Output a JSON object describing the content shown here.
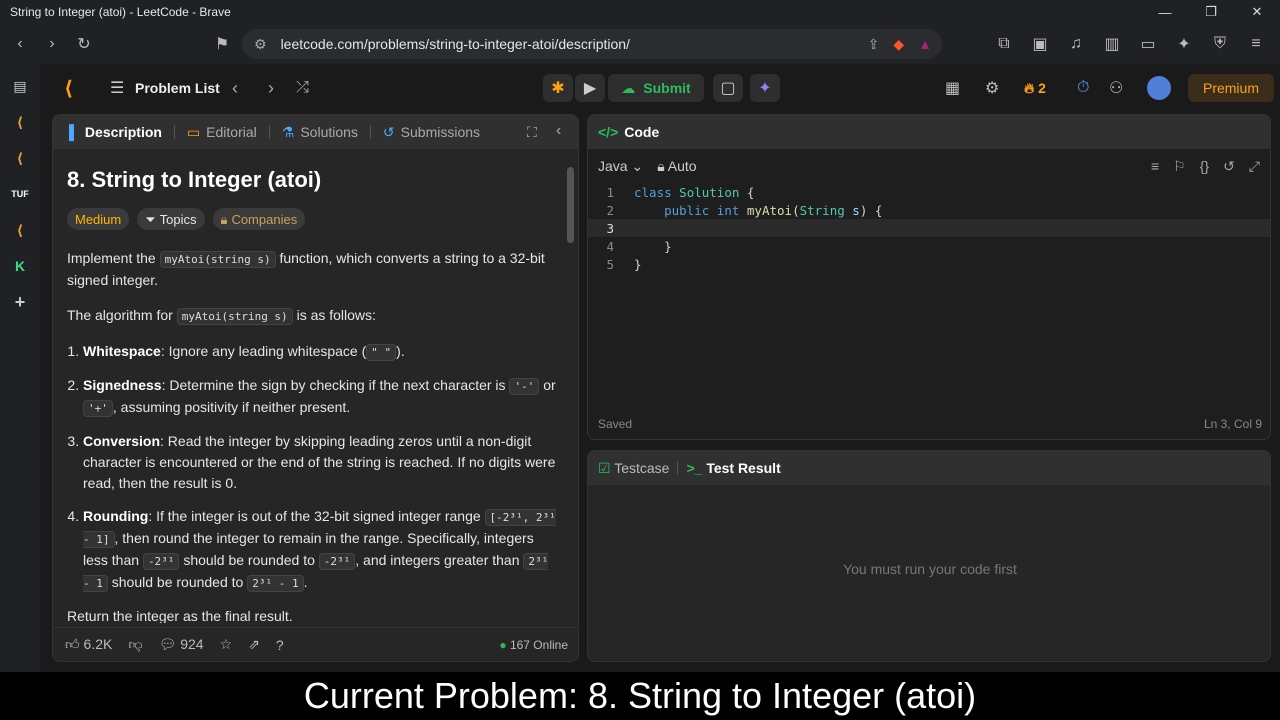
{
  "window": {
    "title": "String to Integer (atoi) - LeetCode - Brave",
    "minimize": "—",
    "restore": "❐",
    "close": "✕"
  },
  "browser": {
    "url": "leetcode.com/problems/string-to-integer-atoi/description/"
  },
  "lcnav": {
    "problem_list": "Problem List",
    "submit": "Submit",
    "streak": "2",
    "premium": "Premium"
  },
  "left_tabs": {
    "description": "Description",
    "editorial": "Editorial",
    "solutions": "Solutions",
    "submissions": "Submissions"
  },
  "problem": {
    "title": "8. String to Integer (atoi)",
    "difficulty": "Medium",
    "topics": "Topics",
    "companies": "Companies",
    "p1_a": "Implement the ",
    "p1_code": "myAtoi(string s)",
    "p1_b": " function, which converts a string to a 32-bit signed integer.",
    "p2_a": "The algorithm for ",
    "p2_code": "myAtoi(string s)",
    "p2_b": " is as follows:",
    "s1_title": "Whitespace",
    "s1_a": ": Ignore any leading whitespace (",
    "s1_code": "\" \"",
    "s1_b": ").",
    "s2_title": "Signedness",
    "s2_a": ": Determine the sign by checking if the next character is ",
    "s2_code1": "'-'",
    "s2_b": " or ",
    "s2_code2": "'+'",
    "s2_c": ", assuming positivity if neither present.",
    "s3_title": "Conversion",
    "s3_a": ": Read the integer by skipping leading zeros until a non-digit character is encountered or the end of the string is reached. If no digits were read, then the result is 0.",
    "s4_title": "Rounding",
    "s4_a": ": If the integer is out of the 32-bit signed integer range ",
    "s4_code1": "[-2³¹, 2³¹ - 1]",
    "s4_b": ", then round the integer to remain in the range. Specifically, integers less than ",
    "s4_code2": "-2³¹",
    "s4_c": " should be rounded to ",
    "s4_code3": "-2³¹",
    "s4_d": ", and integers greater than ",
    "s4_code4": "2³¹ - 1",
    "s4_e": " should be rounded to ",
    "s4_code5": "2³¹ - 1",
    "s4_f": ".",
    "last": "Return the integer as the final result."
  },
  "footer": {
    "likes": "6.2K",
    "comments": "924",
    "online": "167 Online"
  },
  "code": {
    "header": "Code",
    "language": "Java",
    "mode": "Auto",
    "saved": "Saved",
    "cursor": "Ln 3, Col 9",
    "lines": [
      {
        "n": "1"
      },
      {
        "n": "2"
      },
      {
        "n": "3"
      },
      {
        "n": "4"
      },
      {
        "n": "5"
      }
    ],
    "l1_kw": "class",
    "l1_ty": "Solution",
    "l1_rest": " {",
    "l2_kw1": "public",
    "l2_kw2": "int",
    "l2_fn": "myAtoi",
    "l2_ty": "String",
    "l2_id": "s",
    "l2_rest": ") {",
    "l4": "    }",
    "l5": "}"
  },
  "test": {
    "testcase": "Testcase",
    "result": "Test Result",
    "message": "You must run your code first"
  },
  "caption": "Current Problem: 8. String to Integer (atoi)",
  "colors": {
    "accent": "#ffa116",
    "submit": "#2cbb5d",
    "medium": "#ffb800"
  }
}
